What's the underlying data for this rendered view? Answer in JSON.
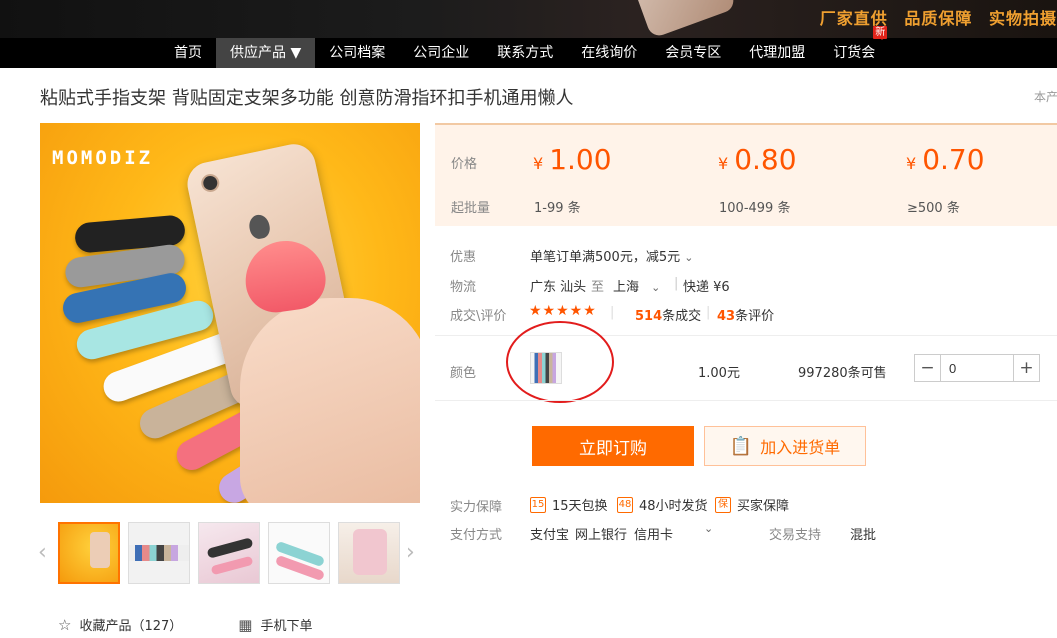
{
  "banner": {
    "slogans": [
      "厂家直供",
      "品质保障",
      "实物拍摄"
    ]
  },
  "nav": {
    "items": [
      {
        "label": "首页"
      },
      {
        "label": "供应产品 ▼"
      },
      {
        "label": "公司档案"
      },
      {
        "label": "公司企业"
      },
      {
        "label": "联系方式"
      },
      {
        "label": "在线询价"
      },
      {
        "label": "会员专区"
      },
      {
        "label": "代理加盟"
      },
      {
        "label": "订货会"
      }
    ],
    "new_badge": "新"
  },
  "product": {
    "title": "粘贴式手指支架 背贴固定支架多功能 创意防滑指环扣手机通用懒人",
    "title_right": "本产",
    "brand": "MOMODIZ"
  },
  "price_box": {
    "price_label": "价格",
    "qty_label": "起批量",
    "currency": "¥",
    "tiers": [
      {
        "price": "1.00",
        "qty": "1-99 条"
      },
      {
        "price": "0.80",
        "qty": "100-499 条"
      },
      {
        "price": "0.70",
        "qty": "≥500 条"
      }
    ]
  },
  "info": {
    "discount_label": "优惠",
    "discount_value": "单笔订单满500元，减5元",
    "logistics_label": "物流",
    "from": "广东 汕头",
    "to_word": "至",
    "to": "上海",
    "express": "快递 ¥6",
    "trade_label": "成交\\评价",
    "stars": "★★★★★",
    "deals_count": "514",
    "deals_suffix": "条成交",
    "reviews_count": "43",
    "reviews_suffix": "条评价"
  },
  "color_row": {
    "label": "颜色",
    "unit_price": "1.00元",
    "stock": "997280条可售",
    "quantity": "0",
    "minus": "−",
    "plus": "+"
  },
  "buttons": {
    "buy": "立即订购",
    "cart": "加入进货单"
  },
  "guarantees": {
    "label": "实力保障",
    "items": [
      {
        "icon": "15",
        "text": "15天包换"
      },
      {
        "icon": "48",
        "text": "48小时发货"
      },
      {
        "icon": "保",
        "text": "买家保障"
      }
    ]
  },
  "payment": {
    "label": "支付方式",
    "methods": [
      "支付宝",
      "网上银行",
      "信用卡"
    ],
    "trade_support_label": "交易支持",
    "trade_support_value": "混批"
  },
  "actions": {
    "favorite": "收藏产品（127）",
    "mobile_order": "手机下单"
  }
}
